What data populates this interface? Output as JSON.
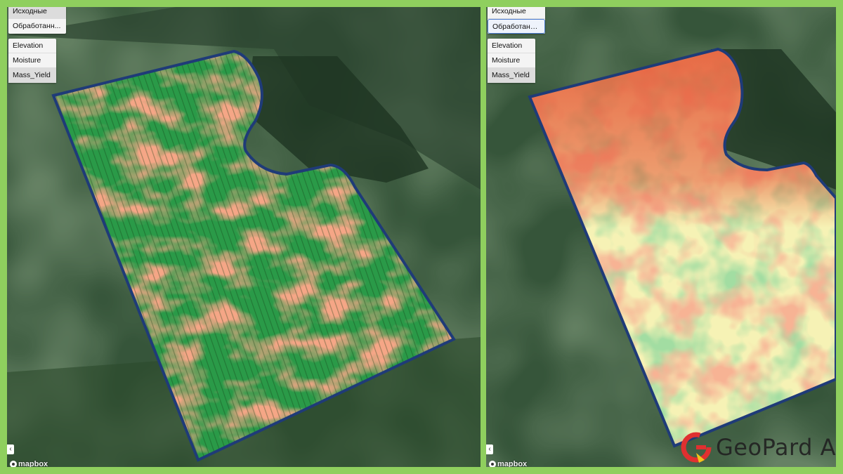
{
  "left_panel": {
    "view_buttons": [
      {
        "label": "Исходные",
        "state": "active"
      },
      {
        "label": "Обработанн...",
        "state": "normal"
      }
    ],
    "layer_buttons": [
      {
        "label": "Elevation"
      },
      {
        "label": "Moisture"
      },
      {
        "label": "Mass_Yield",
        "state": "active"
      }
    ],
    "collapse_label": "‹",
    "attribution": "mapbox"
  },
  "right_panel": {
    "view_buttons": [
      {
        "label": "Исходные",
        "state": "normal"
      },
      {
        "label": "Обработанн...",
        "state": "selected"
      }
    ],
    "layer_buttons": [
      {
        "label": "Elevation"
      },
      {
        "label": "Moisture"
      },
      {
        "label": "Mass_Yield",
        "state": "active"
      }
    ],
    "collapse_label": "‹",
    "attribution": "mapbox"
  },
  "brand": {
    "text": "GeoPard A",
    "logo_letter": "G"
  },
  "colors": {
    "background_frame": "#8fcf5e",
    "field_border": "#1f3b78",
    "high_yield": "#1f9b45",
    "low_yield": "#e8623e",
    "mid_yield": "#f6f2b5",
    "logo_red": "#e03030",
    "logo_yellow": "#f2c21b"
  }
}
